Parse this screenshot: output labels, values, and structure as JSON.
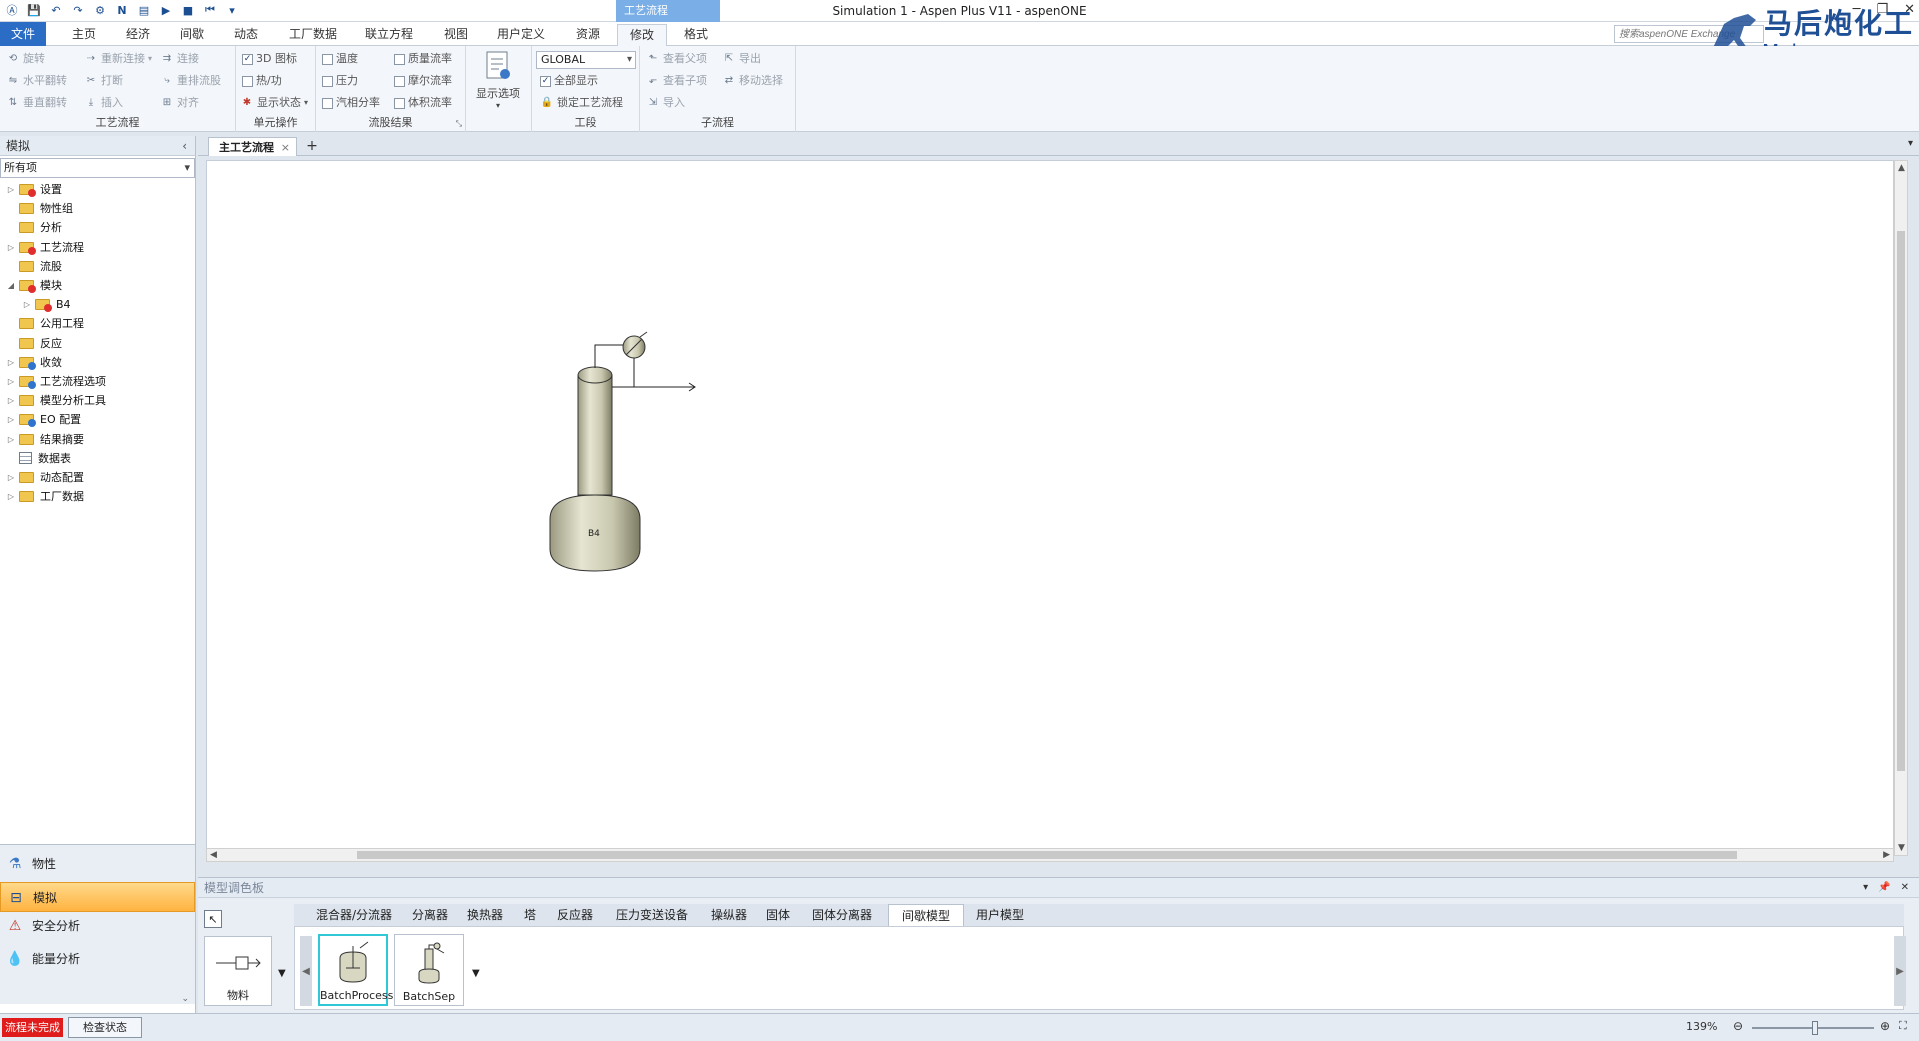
{
  "window": {
    "title": "Simulation 1 - Aspen Plus V11 - aspenONE",
    "context_tab_label": "工艺流程",
    "search_placeholder": "搜索aspenONE Exchange",
    "watermark_cn": "马后炮化工",
    "watermark_url": "Mahoupao.com"
  },
  "ribbon_tabs": [
    "文件",
    "主页",
    "经济",
    "间歇",
    "动态",
    "工厂数据",
    "联立方程",
    "视图",
    "用户定义",
    "资源",
    "修改",
    "格式"
  ],
  "ribbon_active_tab": "修改",
  "ribbon": {
    "flowsheet": {
      "title": "工艺流程",
      "rotate": "旋转",
      "hflip": "水平翻转",
      "vflip": "垂直翻转",
      "reconnect": "重新连接",
      "break": "打断",
      "insert": "插入",
      "connect": "连接",
      "reroute": "重排流股",
      "align": "对齐"
    },
    "unit_ops": {
      "title": "单元操作",
      "icons3d": "3D 图标",
      "heat_work": "热/功",
      "show_status": "显示状态"
    },
    "stream_results": {
      "title": "流股结果",
      "temperature": "温度",
      "pressure": "压力",
      "vapor_fraction": "汽相分率",
      "mass_flow": "质量流率",
      "mole_flow": "摩尔流率",
      "volume_flow": "体积流率"
    },
    "display_options": "显示选项",
    "section": {
      "title": "工段",
      "global": "GLOBAL",
      "show_all": "全部显示",
      "lock_flowsheet": "锁定工艺流程"
    },
    "hierarchy": {
      "title": "子流程",
      "view_parent": "查看父项",
      "view_child": "查看子项",
      "import": "导入",
      "export": "导出",
      "move_selection": "移动选择"
    }
  },
  "nav": {
    "header": "模拟",
    "filter": "所有项",
    "tree": [
      {
        "label": "设置",
        "icon": "folder-red",
        "expander": "closed",
        "indent": 0
      },
      {
        "label": "物性组",
        "icon": "folder",
        "expander": "none",
        "indent": 0
      },
      {
        "label": "分析",
        "icon": "folder",
        "expander": "none",
        "indent": 0
      },
      {
        "label": "工艺流程",
        "icon": "folder-red",
        "expander": "closed",
        "indent": 0
      },
      {
        "label": "流股",
        "icon": "folder",
        "expander": "none",
        "indent": 0
      },
      {
        "label": "模块",
        "icon": "folder-red",
        "expander": "open",
        "indent": 0
      },
      {
        "label": "B4",
        "icon": "folder-red",
        "expander": "closed",
        "indent": 1
      },
      {
        "label": "公用工程",
        "icon": "folder",
        "expander": "none",
        "indent": 0
      },
      {
        "label": "反应",
        "icon": "folder",
        "expander": "none",
        "indent": 0
      },
      {
        "label": "收敛",
        "icon": "folder-blue",
        "expander": "closed",
        "indent": 0
      },
      {
        "label": "工艺流程选项",
        "icon": "folder-blue",
        "expander": "closed",
        "indent": 0
      },
      {
        "label": "模型分析工具",
        "icon": "folder",
        "expander": "closed",
        "indent": 0
      },
      {
        "label": "EO 配置",
        "icon": "folder-blue",
        "expander": "closed",
        "indent": 0
      },
      {
        "label": "结果摘要",
        "icon": "folder",
        "expander": "closed",
        "indent": 0
      },
      {
        "label": "数据表",
        "icon": "sheet",
        "expander": "none",
        "indent": 0
      },
      {
        "label": "动态配置",
        "icon": "folder",
        "expander": "closed",
        "indent": 0
      },
      {
        "label": "工厂数据",
        "icon": "folder",
        "expander": "closed",
        "indent": 0
      }
    ],
    "sections": [
      {
        "label": "物性",
        "active": false
      },
      {
        "label": "模拟",
        "active": true
      },
      {
        "label": "安全分析",
        "active": false
      },
      {
        "label": "能量分析",
        "active": false
      }
    ]
  },
  "doc_tabs": {
    "main": "主工艺流程"
  },
  "flowsheet": {
    "block_label": "B4"
  },
  "palette": {
    "header": "模型调色板",
    "tabs": [
      "混合器/分流器",
      "分离器",
      "换热器",
      "塔",
      "反应器",
      "压力变送设备",
      "操纵器",
      "固体",
      "固体分离器",
      "间歇模型",
      "用户模型"
    ],
    "active_tab": "间歇模型",
    "material": "物料",
    "models": [
      "BatchProcess",
      "BatchSep"
    ]
  },
  "status": {
    "incomplete": "流程未完成",
    "check_status": "检查状态",
    "zoom": "139%"
  },
  "colors": {
    "file_tab": "#2b6cc4",
    "status_error": "#e01b1b",
    "nav_active": "#ffb340",
    "selection_cyan": "#30c7d6"
  }
}
